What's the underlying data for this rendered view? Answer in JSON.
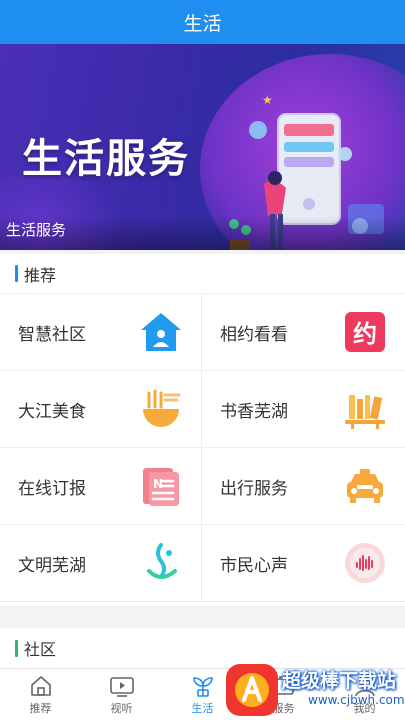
{
  "header": {
    "title": "生活"
  },
  "banner": {
    "title": "生活服务",
    "caption": "生活服务"
  },
  "recommend": {
    "title": "推荐",
    "items": [
      {
        "label": "智慧社区",
        "icon": "house-icon"
      },
      {
        "label": "相约看看",
        "icon": "yue-icon"
      },
      {
        "label": "大江美食",
        "icon": "noodle-bowl-icon"
      },
      {
        "label": "书香芜湖",
        "icon": "bookshelf-icon"
      },
      {
        "label": "在线订报",
        "icon": "newspaper-icon"
      },
      {
        "label": "出行服务",
        "icon": "taxi-icon"
      },
      {
        "label": "文明芜湖",
        "icon": "civilization-logo-icon"
      },
      {
        "label": "市民心声",
        "icon": "voice-logo-icon"
      }
    ]
  },
  "community": {
    "title": "社区"
  },
  "tabbar": {
    "items": [
      {
        "label": "推荐",
        "icon": "home-icon"
      },
      {
        "label": "视听",
        "icon": "tv-play-icon"
      },
      {
        "label": "生活",
        "icon": "sprout-icon",
        "active": true
      },
      {
        "label": "服务",
        "icon": "service-icon"
      },
      {
        "label": "我的",
        "icon": "profile-icon"
      }
    ]
  },
  "watermark": {
    "text": "超级棒下载站",
    "url": "www.cjbwh.com"
  },
  "colors": {
    "brand": "#1e8ef0",
    "community_accent": "#2bb673"
  }
}
